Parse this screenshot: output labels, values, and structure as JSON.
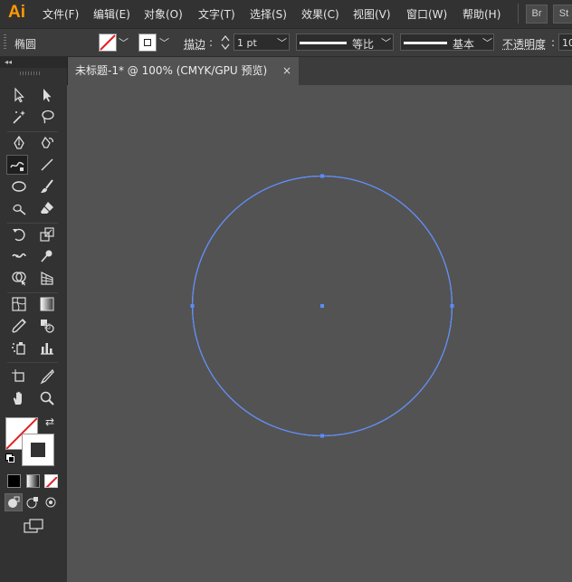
{
  "app": {
    "logo": "Ai",
    "bridge": "Br",
    "stock": "St"
  },
  "menu": [
    {
      "key": "file",
      "label": "文件(F)"
    },
    {
      "key": "edit",
      "label": "编辑(E)"
    },
    {
      "key": "object",
      "label": "对象(O)"
    },
    {
      "key": "type",
      "label": "文字(T)"
    },
    {
      "key": "select",
      "label": "选择(S)"
    },
    {
      "key": "effect",
      "label": "效果(C)"
    },
    {
      "key": "view",
      "label": "视图(V)"
    },
    {
      "key": "window",
      "label": "窗口(W)"
    },
    {
      "key": "help",
      "label": "帮助(H)"
    }
  ],
  "control": {
    "object_type": "椭圆",
    "stroke_label": "描边",
    "stroke_weight": "1 pt",
    "profile_uniform": "等比",
    "brush_basic": "基本",
    "opacity_label": "不透明度",
    "opacity_value": "10"
  },
  "document": {
    "tab_title": "未标题-1* @ 100% (CMYK/GPU 预览)",
    "close": "×"
  },
  "colors": {
    "path_selection": "#5b8cff",
    "canvas": "#535353",
    "logo": "#ff9a00"
  },
  "tools": [
    "selection-tool",
    "direct-selection-tool",
    "magic-wand-tool",
    "lasso-tool",
    "pen-tool",
    "curvature-tool",
    "shaper-tool",
    "line-segment-tool",
    "ellipse-tool",
    "paintbrush-tool",
    "blob-brush-tool",
    "eraser-tool",
    "rotate-tool",
    "scale-tool",
    "width-tool",
    "puppet-warp-tool",
    "shape-builder-tool",
    "perspective-grid-tool",
    "mesh-tool",
    "gradient-tool",
    "eyedropper-tool",
    "blend-tool",
    "symbol-sprayer-tool",
    "column-graph-tool",
    "artboard-tool",
    "slice-tool",
    "hand-tool",
    "zoom-tool"
  ]
}
